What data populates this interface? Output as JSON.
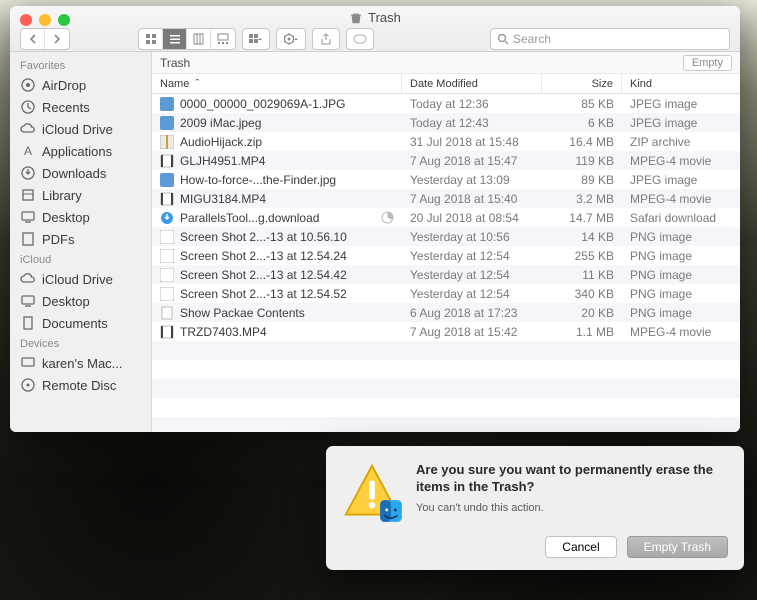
{
  "window": {
    "title": "Trash",
    "path_label": "Trash",
    "empty_label": "Empty",
    "search_placeholder": "Search"
  },
  "columns": {
    "name": "Name",
    "date": "Date Modified",
    "size": "Size",
    "kind": "Kind"
  },
  "sidebar": {
    "groups": [
      {
        "label": "Favorites",
        "items": [
          {
            "icon": "airdrop",
            "label": "AirDrop"
          },
          {
            "icon": "clock",
            "label": "Recents"
          },
          {
            "icon": "cloud",
            "label": "iCloud Drive"
          },
          {
            "icon": "apps",
            "label": "Applications"
          },
          {
            "icon": "download",
            "label": "Downloads"
          },
          {
            "icon": "library",
            "label": "Library"
          },
          {
            "icon": "desktop",
            "label": "Desktop"
          },
          {
            "icon": "pdf",
            "label": "PDFs"
          }
        ]
      },
      {
        "label": "iCloud",
        "items": [
          {
            "icon": "cloud",
            "label": "iCloud Drive"
          },
          {
            "icon": "desktop",
            "label": "Desktop"
          },
          {
            "icon": "doc",
            "label": "Documents"
          }
        ]
      },
      {
        "label": "Devices",
        "items": [
          {
            "icon": "mac",
            "label": "karen's Mac..."
          },
          {
            "icon": "disc",
            "label": "Remote Disc"
          }
        ]
      }
    ]
  },
  "files": [
    {
      "icon": "jpg",
      "name": "0000_00000_0029069A-1.JPG",
      "date": "Today at 12:36",
      "size": "85 KB",
      "kind": "JPEG image"
    },
    {
      "icon": "jpg",
      "name": "2009 iMac.jpeg",
      "date": "Today at 12:43",
      "size": "6 KB",
      "kind": "JPEG image"
    },
    {
      "icon": "zip",
      "name": "AudioHijack.zip",
      "date": "31 Jul 2018 at 15:48",
      "size": "16.4 MB",
      "kind": "ZIP archive"
    },
    {
      "icon": "mov",
      "name": "GLJH4951.MP4",
      "date": "7 Aug 2018 at 15:47",
      "size": "119 KB",
      "kind": "MPEG-4 movie"
    },
    {
      "icon": "jpg",
      "name": "How-to-force-...the-Finder.jpg",
      "date": "Yesterday at 13:09",
      "size": "89 KB",
      "kind": "JPEG image"
    },
    {
      "icon": "mov",
      "name": "MIGU3184.MP4",
      "date": "7 Aug 2018 at 15:40",
      "size": "3.2 MB",
      "kind": "MPEG-4 movie"
    },
    {
      "icon": "dl",
      "name": "ParallelsTool...g.download",
      "date": "20 Jul 2018 at 08:54",
      "size": "14.7 MB",
      "kind": "Safari download"
    },
    {
      "icon": "png",
      "name": "Screen Shot 2...-13 at 10.56.10",
      "date": "Yesterday at 10:56",
      "size": "14 KB",
      "kind": "PNG image"
    },
    {
      "icon": "png",
      "name": "Screen Shot 2...-13 at 12.54.24",
      "date": "Yesterday at 12:54",
      "size": "255 KB",
      "kind": "PNG image"
    },
    {
      "icon": "png",
      "name": "Screen Shot 2...-13 at 12.54.42",
      "date": "Yesterday at 12:54",
      "size": "11 KB",
      "kind": "PNG image"
    },
    {
      "icon": "png",
      "name": "Screen Shot 2...-13 at 12.54.52",
      "date": "Yesterday at 12:54",
      "size": "340 KB",
      "kind": "PNG image"
    },
    {
      "icon": "txt",
      "name": "Show Packae Contents",
      "date": "6 Aug 2018 at 17:23",
      "size": "20 KB",
      "kind": "PNG image"
    },
    {
      "icon": "mov",
      "name": "TRZD7403.MP4",
      "date": "7 Aug 2018 at 15:42",
      "size": "1.1 MB",
      "kind": "MPEG-4 movie"
    }
  ],
  "dialog": {
    "heading": "Are you sure you want to permanently erase the items in the Trash?",
    "sub": "You can't undo this action.",
    "cancel": "Cancel",
    "confirm": "Empty Trash"
  }
}
